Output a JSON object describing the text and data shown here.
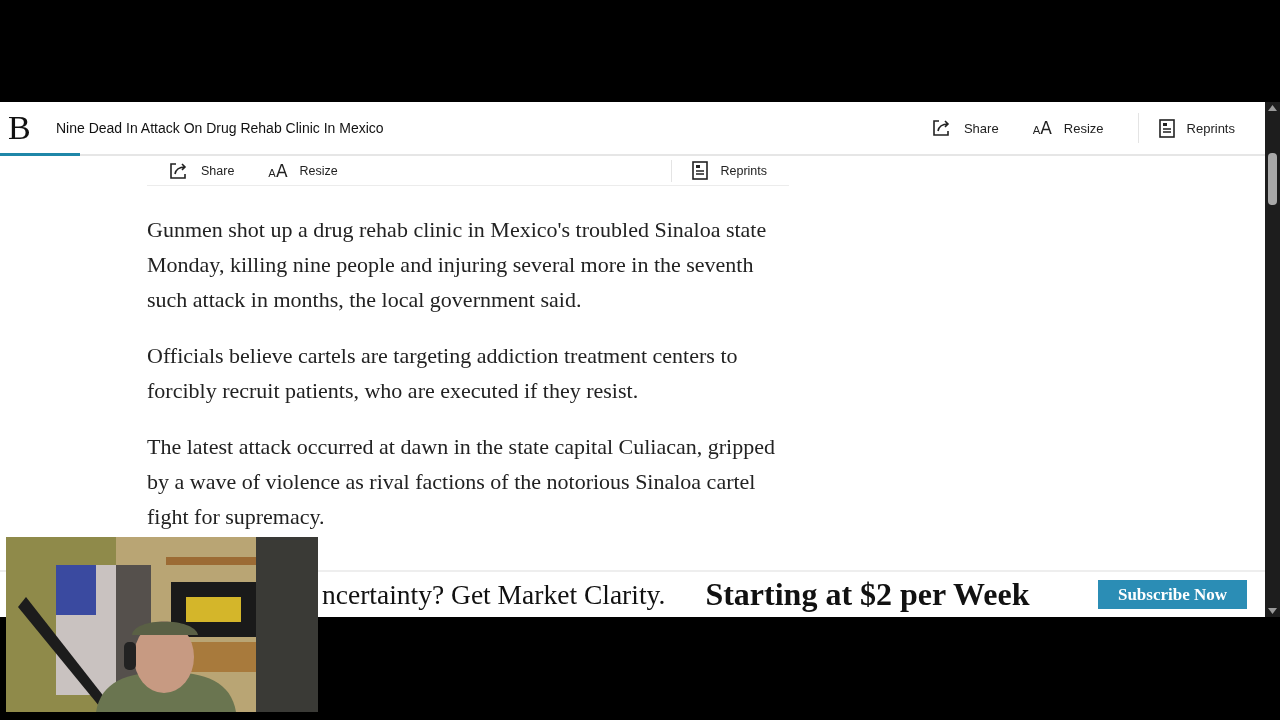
{
  "article_header": {
    "logo": "B",
    "title": "Nine Dead In Attack On Drug Rehab Clinic In Mexico",
    "progress": {
      "level": 0.063
    },
    "actions": [
      {
        "kind": "share",
        "label": "Share"
      },
      {
        "kind": "resize",
        "icon": "AA",
        "label": "Resize"
      },
      {
        "kind": "reprints",
        "label": "Reprints"
      }
    ]
  },
  "article_toolbar": {
    "actions": [
      {
        "kind": "share",
        "label": "Share"
      },
      {
        "kind": "resize",
        "icon": "AA",
        "label": "Resize"
      },
      {
        "kind": "reprints",
        "label": "Reprints"
      }
    ]
  },
  "paragraphs": [
    "Gunmen shot up a drug rehab clinic in Mexico's troubled Sinaloa state Monday, killing nine people and injuring several more in the seventh such attack in months, the local government said.",
    "Officials believe cartels are targeting addiction treatment centers to forcibly recruit patients, who are executed if they resist.",
    "The latest attack occurred at dawn in the state capital Culiacan, gripped by a wave of violence as rival factions of the notorious Sinaloa cartel fight for supremacy."
  ],
  "subscribe_banner": {
    "tagline": "ncertainty? Get Market Clarity.",
    "offer": "Starting at $2 per Week",
    "button": "Subscribe Now"
  }
}
